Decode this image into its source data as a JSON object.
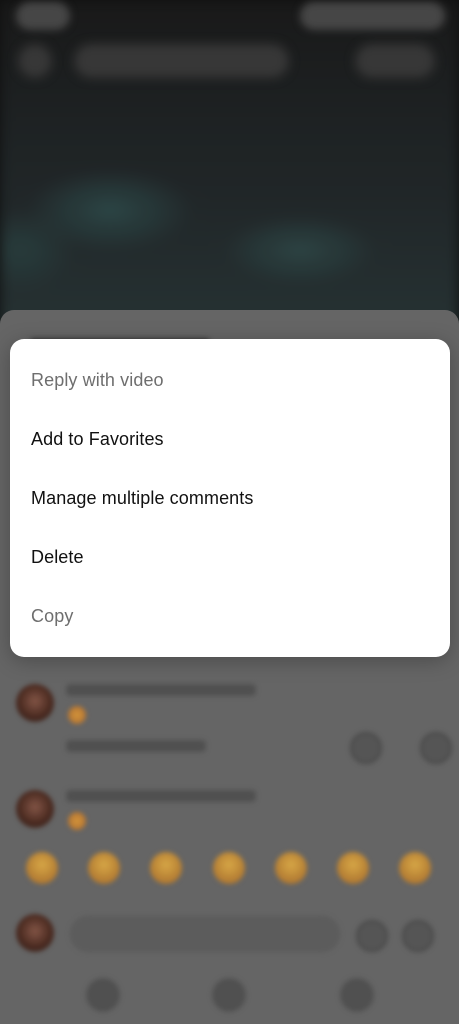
{
  "menu": {
    "items": [
      {
        "label": "Reply with video",
        "muted": true
      },
      {
        "label": "Add to Favorites",
        "muted": false
      },
      {
        "label": "Manage multiple comments",
        "muted": false
      },
      {
        "label": "Delete",
        "muted": false
      },
      {
        "label": "Copy",
        "muted": true
      }
    ]
  },
  "colors": {
    "menu_background": "#ffffff",
    "menu_text": "#111111",
    "menu_text_muted": "#6e6e6e",
    "backdrop": "#6b6b6b"
  }
}
